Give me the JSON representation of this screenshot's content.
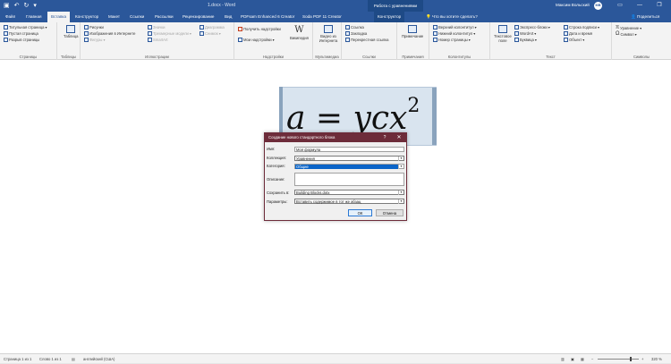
{
  "titlebar": {
    "doc_title": "1.docx  -  Word",
    "context_label": "Работа с уравнениями",
    "user": "Максим Вольский",
    "avatar_initials": "МВ"
  },
  "tabs": [
    "Файл",
    "Главная",
    "Вставка",
    "Конструктор",
    "Макет",
    "Ссылки",
    "Рассылки",
    "Рецензирование",
    "Вид",
    "PDFsam Enhanced 6 Creator",
    "Soda PDF 11 Creator",
    "Конструктор"
  ],
  "tell_me": "Что вы хотите сделать?",
  "share": "Поделиться",
  "ribbon": {
    "pages": {
      "label": "Страницы",
      "items": [
        "Титульная страница",
        "Пустая страница",
        "Разрыв страницы"
      ]
    },
    "tables": {
      "label": "Таблицы",
      "items": [
        "Таблица"
      ]
    },
    "illustrations": {
      "label": "Иллюстрации",
      "items": [
        "Рисунки",
        "Изображения в Интернете",
        "Фигуры",
        "Значки",
        "Трехмерные модели",
        "SmartArt",
        "Диаграмма",
        "Снимок"
      ]
    },
    "addins": {
      "label": "Надстройки",
      "items": [
        "Получить надстройки",
        "Мои надстройки",
        "Википедия"
      ]
    },
    "media": {
      "label": "Мультимедиа",
      "items": [
        "Видео из Интернета"
      ]
    },
    "links": {
      "label": "Ссылки",
      "items": [
        "Ссылка",
        "Закладка",
        "Перекрестная ссылка"
      ]
    },
    "comments": {
      "label": "Примечания",
      "items": [
        "Примечание"
      ]
    },
    "header_footer": {
      "label": "Колонтитулы",
      "items": [
        "Верхний колонтитул",
        "Нижний колонтитул",
        "Номер страницы"
      ]
    },
    "text": {
      "label": "Текст",
      "items": [
        "Текстовое поле",
        "Экспресс-блоки",
        "WordArt",
        "Буквица",
        "Строка подписи",
        "Дата и время",
        "Объект"
      ]
    },
    "symbols": {
      "label": "Символы",
      "items": [
        "Уравнение",
        "Символ"
      ]
    }
  },
  "equation": {
    "a": "a",
    "eq": "=",
    "rest": "ycx",
    "exp": "2"
  },
  "dialog": {
    "title": "Создание нового стандартного блока",
    "help": "?",
    "name_label": "Имя:",
    "name_value": "Моя формула",
    "gallery_label": "Коллекция:",
    "gallery_value": "Уравнения",
    "category_label": "Категория:",
    "category_value": "Общие",
    "description_label": "Описание:",
    "save_in_label": "Сохранить в:",
    "save_in_value": "Building Blocks.dotx",
    "options_label": "Параметры:",
    "options_value": "Вставить содержимое в тот же абзац",
    "ok": "ОК",
    "cancel": "Отмена"
  },
  "status": {
    "page": "Страница 1 из 1",
    "words": "Слово 1 из 1",
    "language": "английский (США)",
    "zoom": "320 %"
  }
}
